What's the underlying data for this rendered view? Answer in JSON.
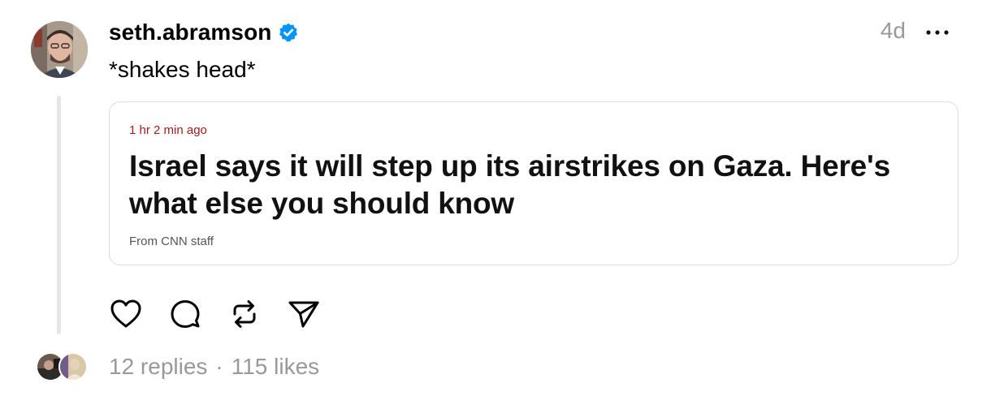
{
  "post": {
    "author": {
      "username": "seth.abramson",
      "verified": true,
      "avatar_icon": "profile-photo"
    },
    "timestamp": "4d",
    "more_icon": "ellipsis-icon",
    "text": "*shakes head*",
    "link_card": {
      "time_ago": "1 hr 2 min ago",
      "headline": "Israel says it will step up its airstrikes on Gaza. Here's what else you should know",
      "byline": "From CNN staff",
      "time_color": "#a41c1c"
    },
    "actions": [
      {
        "name": "like",
        "icon": "heart-icon"
      },
      {
        "name": "reply",
        "icon": "speech-bubble-icon"
      },
      {
        "name": "repost",
        "icon": "repost-arrows-icon"
      },
      {
        "name": "share",
        "icon": "paper-plane-icon"
      }
    ],
    "stats": {
      "replies": "12 replies",
      "separator": "·",
      "likes": "115 likes"
    }
  },
  "colors": {
    "verified_badge": "#0095f6",
    "secondary_text": "#999999",
    "thread_line": "#e6e6e6",
    "card_border": "#dcdcdc"
  }
}
